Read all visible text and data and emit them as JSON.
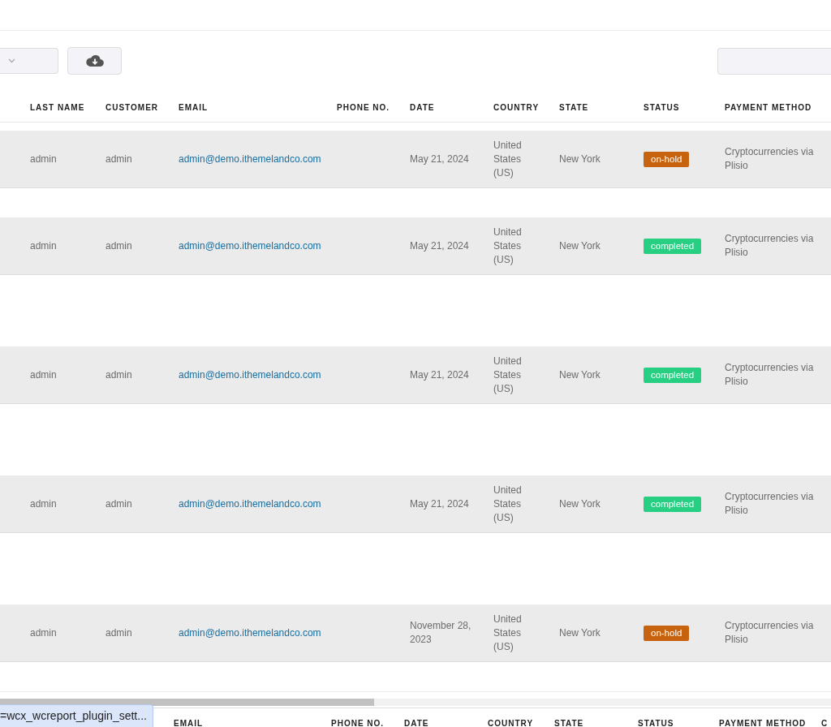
{
  "table": {
    "columns": [
      "LAST NAME",
      "CUSTOMER",
      "EMAIL",
      "PHONE NO.",
      "DATE",
      "COUNTRY",
      "STATE",
      "STATUS",
      "PAYMENT METHOD"
    ],
    "rows": [
      {
        "last_name": "admin",
        "customer": "admin",
        "email": "admin@demo.ithemelandco.com",
        "date": "May 21, 2024",
        "country": "United States (US)",
        "state": "New York",
        "status": {
          "label": "on-hold",
          "kind": "on-hold"
        },
        "payment": "Cryptocurrencies via Plisio"
      },
      {
        "last_name": "admin",
        "customer": "admin",
        "email": "admin@demo.ithemelandco.com",
        "date": "May 21, 2024",
        "country": "United States (US)",
        "state": "New York",
        "status": {
          "label": "completed",
          "kind": "completed"
        },
        "payment": "Cryptocurrencies via Plisio"
      },
      {
        "last_name": "admin",
        "customer": "admin",
        "email": "admin@demo.ithemelandco.com",
        "date": "May 21, 2024",
        "country": "United States (US)",
        "state": "New York",
        "status": {
          "label": "completed",
          "kind": "completed"
        },
        "payment": "Cryptocurrencies via Plisio"
      },
      {
        "last_name": "admin",
        "customer": "admin",
        "email": "admin@demo.ithemelandco.com",
        "date": "May 21, 2024",
        "country": "United States (US)",
        "state": "New York",
        "status": {
          "label": "completed",
          "kind": "completed"
        },
        "payment": "Cryptocurrencies via Plisio"
      },
      {
        "last_name": "admin",
        "customer": "admin",
        "email": "admin@demo.ithemelandco.com",
        "date": "November 28, 2023",
        "country": "United States (US)",
        "state": "New York",
        "status": {
          "label": "on-hold",
          "kind": "on-hold"
        },
        "payment": "Cryptocurrencies via Plisio"
      }
    ],
    "footer_columns": [
      "EMAIL",
      "PHONE NO.",
      "DATE",
      "COUNTRY",
      "STATE",
      "STATUS",
      "PAYMENT METHOD",
      "C"
    ]
  },
  "status_bar": {
    "link_preview": "=wcx_wcreport_plugin_sett..."
  }
}
